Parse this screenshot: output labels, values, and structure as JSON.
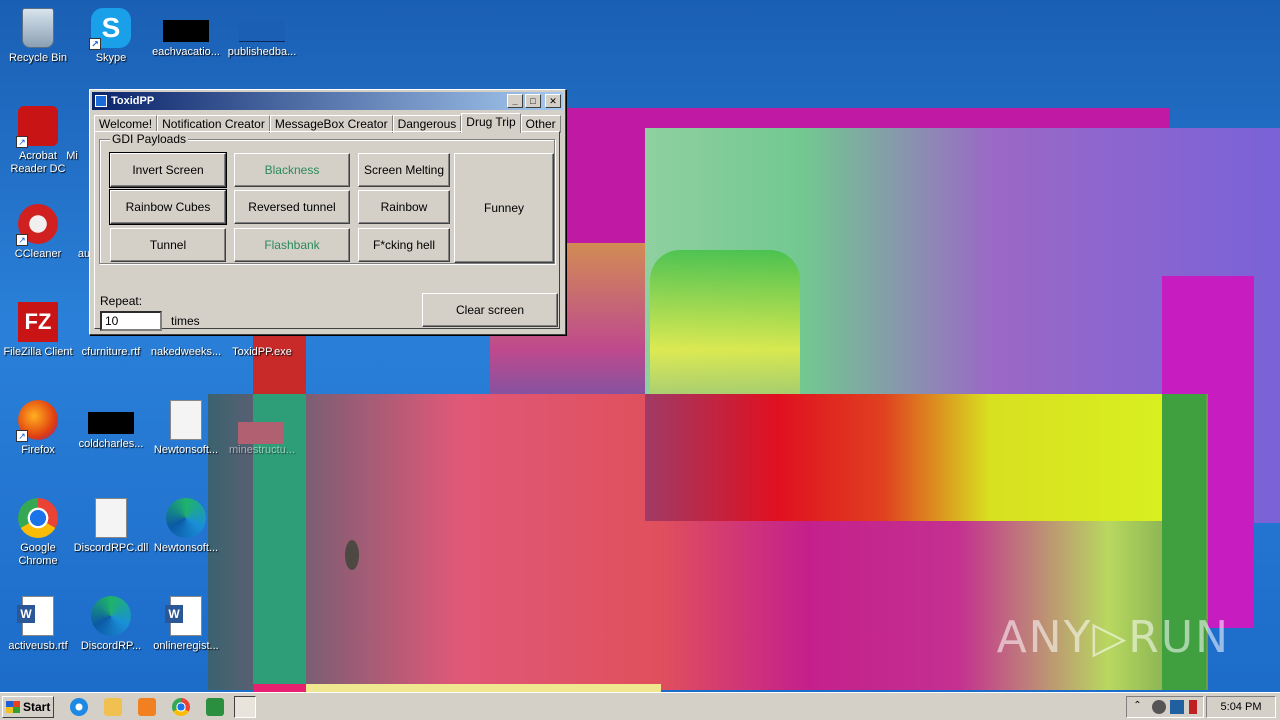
{
  "desktop": {
    "icons": [
      {
        "label": "Recycle Bin"
      },
      {
        "label": "Skype"
      },
      {
        "label": "eachvacatio..."
      },
      {
        "label": "publishedba..."
      },
      {
        "label": "Acrobat Reader DC"
      },
      {
        "label": "Mi"
      },
      {
        "label": "CCleaner"
      },
      {
        "label": "au"
      },
      {
        "label": "FileZilla Client"
      },
      {
        "label": "cfurniture.rtf"
      },
      {
        "label": "nakedweeks..."
      },
      {
        "label": "ToxidPP.exe"
      },
      {
        "label": "Firefox"
      },
      {
        "label": "coldcharles..."
      },
      {
        "label": "Newtonsoft..."
      },
      {
        "label": "minestructu..."
      },
      {
        "label": "Google Chrome"
      },
      {
        "label": "DiscordRPC.dll"
      },
      {
        "label": "Newtonsoft..."
      },
      {
        "label": "activeusb.rtf"
      },
      {
        "label": "DiscordRP..."
      },
      {
        "label": "onlineregist..."
      }
    ]
  },
  "window": {
    "title": "ToxidPP",
    "min_glyph": "_",
    "max_glyph": "□",
    "close_glyph": "✕",
    "tabs": [
      {
        "label": "Welcome!"
      },
      {
        "label": "Notification Creator"
      },
      {
        "label": "MessageBox Creator"
      },
      {
        "label": "Dangerous"
      },
      {
        "label": "Drug Trip"
      },
      {
        "label": "Other"
      }
    ],
    "active_tab": "Drug Trip",
    "group_label": "GDI Payloads",
    "buttons": {
      "invert_screen": "Invert Screen",
      "blackness": "Blackness",
      "screen_melting": "Screen Melting",
      "funney": "Funney",
      "rainbow_cubes": "Rainbow Cubes",
      "reversed_tunnel": "Reversed tunnel",
      "rainbow": "Rainbow",
      "tunnel": "Tunnel",
      "flashbank": "Flashbank",
      "fcking_hell": "F*cking hell",
      "clear_screen": "Clear screen"
    },
    "repeat_label": "Repeat:",
    "repeat_value": "10",
    "times_label": "times"
  },
  "watermark": "ANY▷RUN",
  "taskbar": {
    "start_label": "Start",
    "clock": "5:04 PM"
  }
}
